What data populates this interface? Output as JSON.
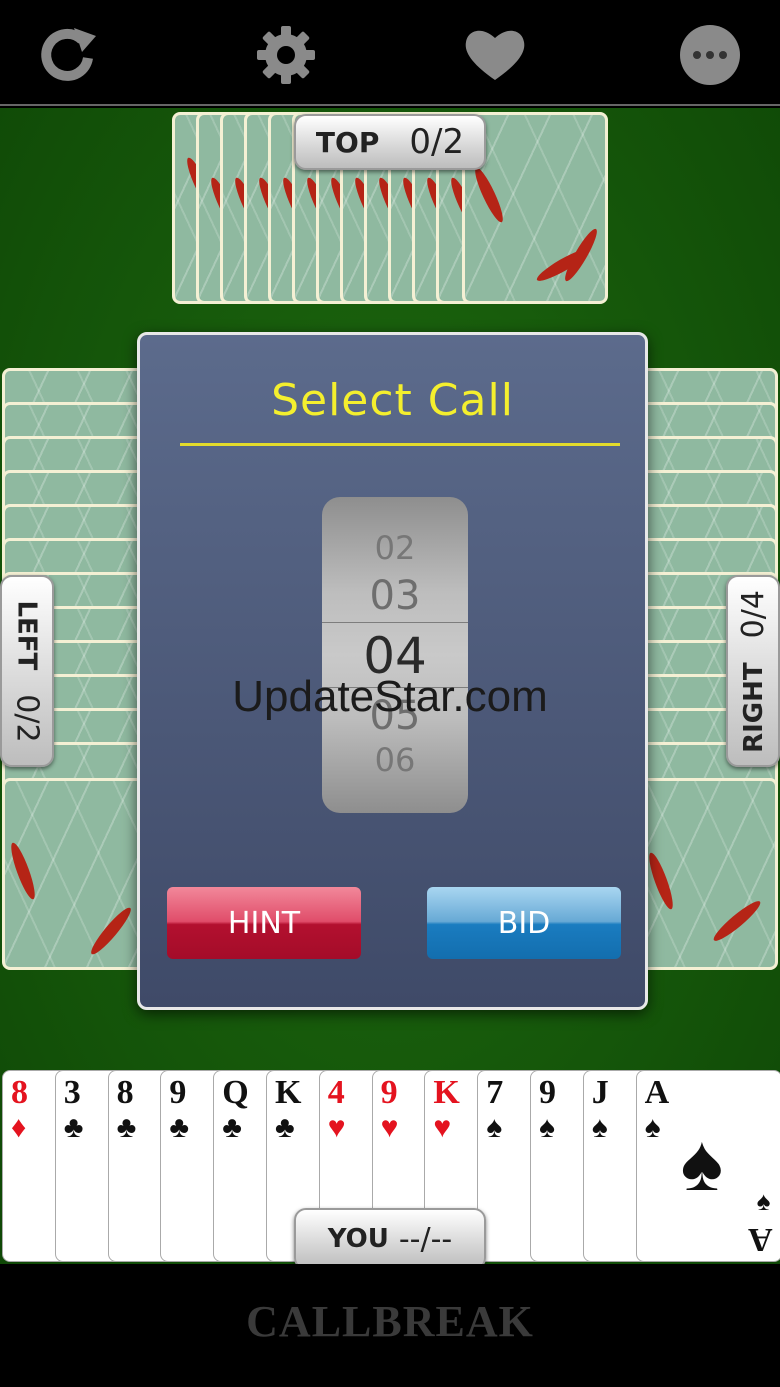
{
  "toolbar": {
    "icons": [
      "refresh-icon",
      "gear-icon",
      "heart-icon",
      "more-icon"
    ]
  },
  "players": {
    "top": {
      "name": "TOP",
      "score": "0/2"
    },
    "left": {
      "name": "LEFT",
      "score": "0/2"
    },
    "right": {
      "name": "RIGHT",
      "score": "0/4"
    },
    "you": {
      "name": "YOU",
      "score": "--/--"
    }
  },
  "dialog": {
    "title": "Select Call",
    "picker": {
      "items": [
        "02",
        "03",
        "04",
        "05",
        "06"
      ],
      "selected": "04"
    },
    "hint_label": "HINT",
    "bid_label": "BID"
  },
  "watermark": "UpdateStar.com",
  "hand": [
    {
      "rank": "8",
      "suit": "♦",
      "color": "red"
    },
    {
      "rank": "3",
      "suit": "♣",
      "color": "black"
    },
    {
      "rank": "8",
      "suit": "♣",
      "color": "black"
    },
    {
      "rank": "9",
      "suit": "♣",
      "color": "black"
    },
    {
      "rank": "Q",
      "suit": "♣",
      "color": "black"
    },
    {
      "rank": "K",
      "suit": "♣",
      "color": "black"
    },
    {
      "rank": "4",
      "suit": "♥",
      "color": "red"
    },
    {
      "rank": "9",
      "suit": "♥",
      "color": "red"
    },
    {
      "rank": "K",
      "suit": "♥",
      "color": "red"
    },
    {
      "rank": "7",
      "suit": "♠",
      "color": "black"
    },
    {
      "rank": "9",
      "suit": "♠",
      "color": "black"
    },
    {
      "rank": "J",
      "suit": "♠",
      "color": "black"
    },
    {
      "rank": "A",
      "suit": "♠",
      "color": "black"
    }
  ],
  "brand": "CALLBREAK",
  "colors": {
    "table": "#1b6410",
    "title": "#f4ef2e",
    "hint": "#c5173a",
    "bid": "#1a7cc0"
  }
}
